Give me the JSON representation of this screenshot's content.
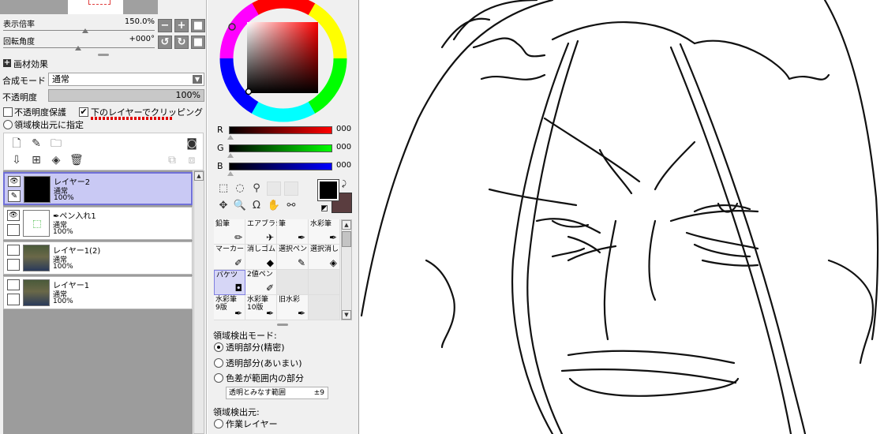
{
  "navigator": {
    "zoom_label": "表示倍率",
    "zoom_value": "150.0%",
    "rotate_label": "回転角度",
    "rotate_value": "+000°",
    "buttons": {
      "zoom_out": "−",
      "zoom_in": "+",
      "reset_zoom": "■",
      "rotate_left": "↺",
      "rotate_right": "↻",
      "reset_rotate": "■"
    }
  },
  "layer_props": {
    "texture_label": "画材効果",
    "blend_label": "合成モード",
    "blend_value": "通常",
    "opacity_label": "不透明度",
    "opacity_value": "100%",
    "protect_label": "不透明度保護",
    "clip_label": "下のレイヤーでクリッピング",
    "source_label": "領域検出元に指定",
    "protect_checked": false,
    "clip_checked": true
  },
  "layers": [
    {
      "name": "レイヤー2",
      "mode": "通常",
      "opacity": "100%",
      "visible": true,
      "selected": true
    },
    {
      "name": "ペン入れ1",
      "mode": "通常",
      "opacity": "100%",
      "visible": true,
      "selected": false
    },
    {
      "name": "レイヤー1(2)",
      "mode": "通常",
      "opacity": "100%",
      "visible": false,
      "selected": false
    },
    {
      "name": "レイヤー1",
      "mode": "通常",
      "opacity": "100%",
      "visible": false,
      "selected": false
    }
  ],
  "color": {
    "r_label": "R",
    "g_label": "G",
    "b_label": "B",
    "r": "000",
    "g": "000",
    "b": "000",
    "primary": "#000000",
    "secondary": "#5a3d3f"
  },
  "tools": [
    {
      "label": "鉛筆",
      "icon": "pencil-icon"
    },
    {
      "label": "エアブラシ",
      "icon": "airbrush-icon"
    },
    {
      "label": "筆",
      "icon": "brush-icon"
    },
    {
      "label": "水彩筆",
      "icon": "watercolor-icon"
    },
    {
      "label": "マーカー",
      "icon": "marker-icon"
    },
    {
      "label": "消しゴム",
      "icon": "eraser-icon"
    },
    {
      "label": "選択ペン",
      "icon": "select-pen-icon"
    },
    {
      "label": "選択消し",
      "icon": "select-erase-icon"
    },
    {
      "label": "バケツ",
      "icon": "bucket-icon"
    },
    {
      "label": "2値ペン",
      "icon": "binary-pen-icon"
    },
    {
      "label": "",
      "icon": ""
    },
    {
      "label": "",
      "icon": ""
    },
    {
      "label": "水彩筆\n9版",
      "icon": "watercolor-icon"
    },
    {
      "label": "水彩筆\n10版",
      "icon": "watercolor-icon"
    },
    {
      "label": "旧水彩",
      "icon": "watercolor-icon"
    },
    {
      "label": "",
      "icon": ""
    }
  ],
  "fill_options": {
    "mode_label": "領域検出モード:",
    "mode_options": [
      "透明部分(精密)",
      "透明部分(あいまい)",
      "色差が範囲内の部分"
    ],
    "range_label": "透明とみなす範囲",
    "range_value": "±9",
    "source_label": "領域検出元:",
    "source_option": "作業レイヤー"
  }
}
